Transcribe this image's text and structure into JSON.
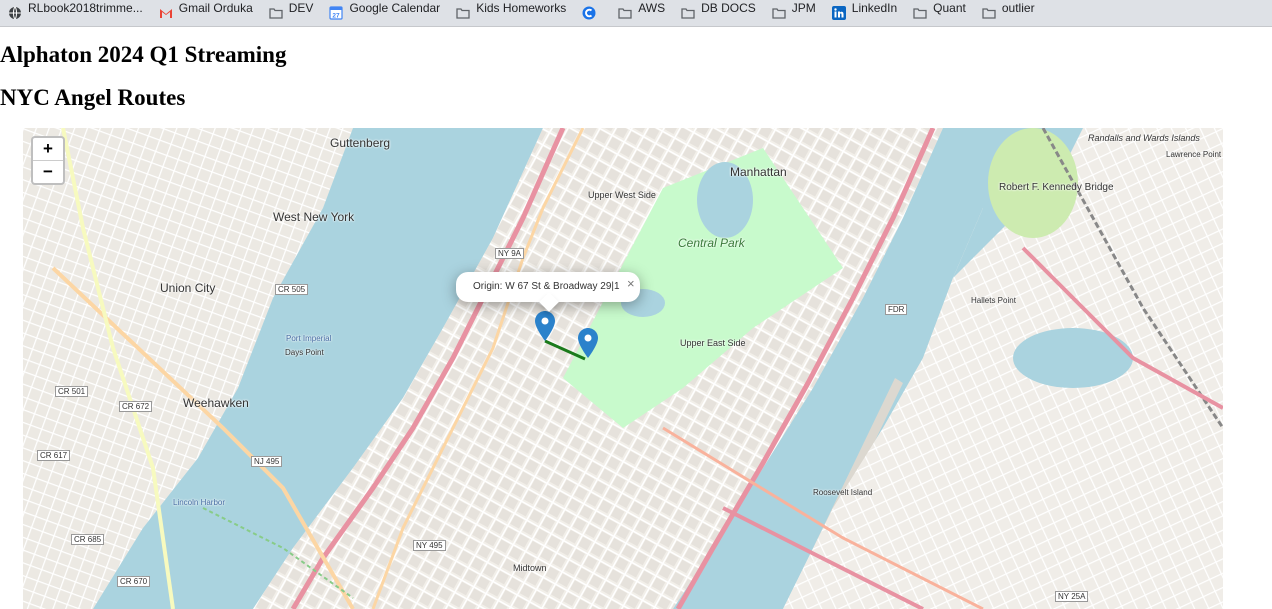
{
  "bookmarks": [
    {
      "label": "RLbook2018trimme...",
      "icon": "globe-icon"
    },
    {
      "label": "Gmail Orduka",
      "icon": "gmail-icon"
    },
    {
      "label": "DEV",
      "icon": "folder-icon"
    },
    {
      "label": "Google Calendar",
      "icon": "calendar-icon"
    },
    {
      "label": "Kids Homeworks",
      "icon": "folder-icon"
    },
    {
      "label": "",
      "icon": "c-app-icon"
    },
    {
      "label": "AWS",
      "icon": "folder-icon"
    },
    {
      "label": "DB DOCS",
      "icon": "folder-icon"
    },
    {
      "label": "JPM",
      "icon": "folder-icon"
    },
    {
      "label": "LinkedIn",
      "icon": "linkedin-icon"
    },
    {
      "label": "Quant",
      "icon": "folder-icon"
    },
    {
      "label": "outlier",
      "icon": "folder-icon"
    }
  ],
  "calendar_day": "27",
  "page": {
    "title": "Alphaton 2024 Q1 Streaming",
    "subtitle": "NYC Angel Routes"
  },
  "map": {
    "zoom_in_label": "+",
    "zoom_out_label": "−",
    "popup_text": "Origin: W 67 St & Broadway 29|1",
    "popup_close": "×",
    "route_color": "#1b7a1b",
    "marker_color": "#2b82cb",
    "labels": {
      "guttenberg": "Guttenberg",
      "west_new_york": "West New York",
      "union_city": "Union City",
      "weehawken": "Weehawken",
      "manhattan": "Manhattan",
      "upper_west_side": "Upper West Side",
      "upper_east_side": "Upper East Side",
      "central_park": "Central Park",
      "randalls": "Randalls and Wards Islands",
      "rfk_bridge": "Robert F. Kennedy Bridge",
      "midtown": "Midtown",
      "roosevelt_island": "Roosevelt Island",
      "hallets_point": "Hallets Point",
      "lawrence_point": "Lawrence Point",
      "ny9a": "NY 9A",
      "nj495": "NJ 495",
      "ny495": "NY 495",
      "fdr": "FDR",
      "cr505": "CR 505",
      "cr501": "CR 501",
      "cr672": "CR 672",
      "cr617": "CR 617",
      "cr685": "CR 685",
      "cr670": "CR 670",
      "ny25a": "NY 25A",
      "port_imperial": "Port Imperial",
      "days_point": "Days Point",
      "lincoln_harbor": "Lincoln Harbor"
    }
  }
}
